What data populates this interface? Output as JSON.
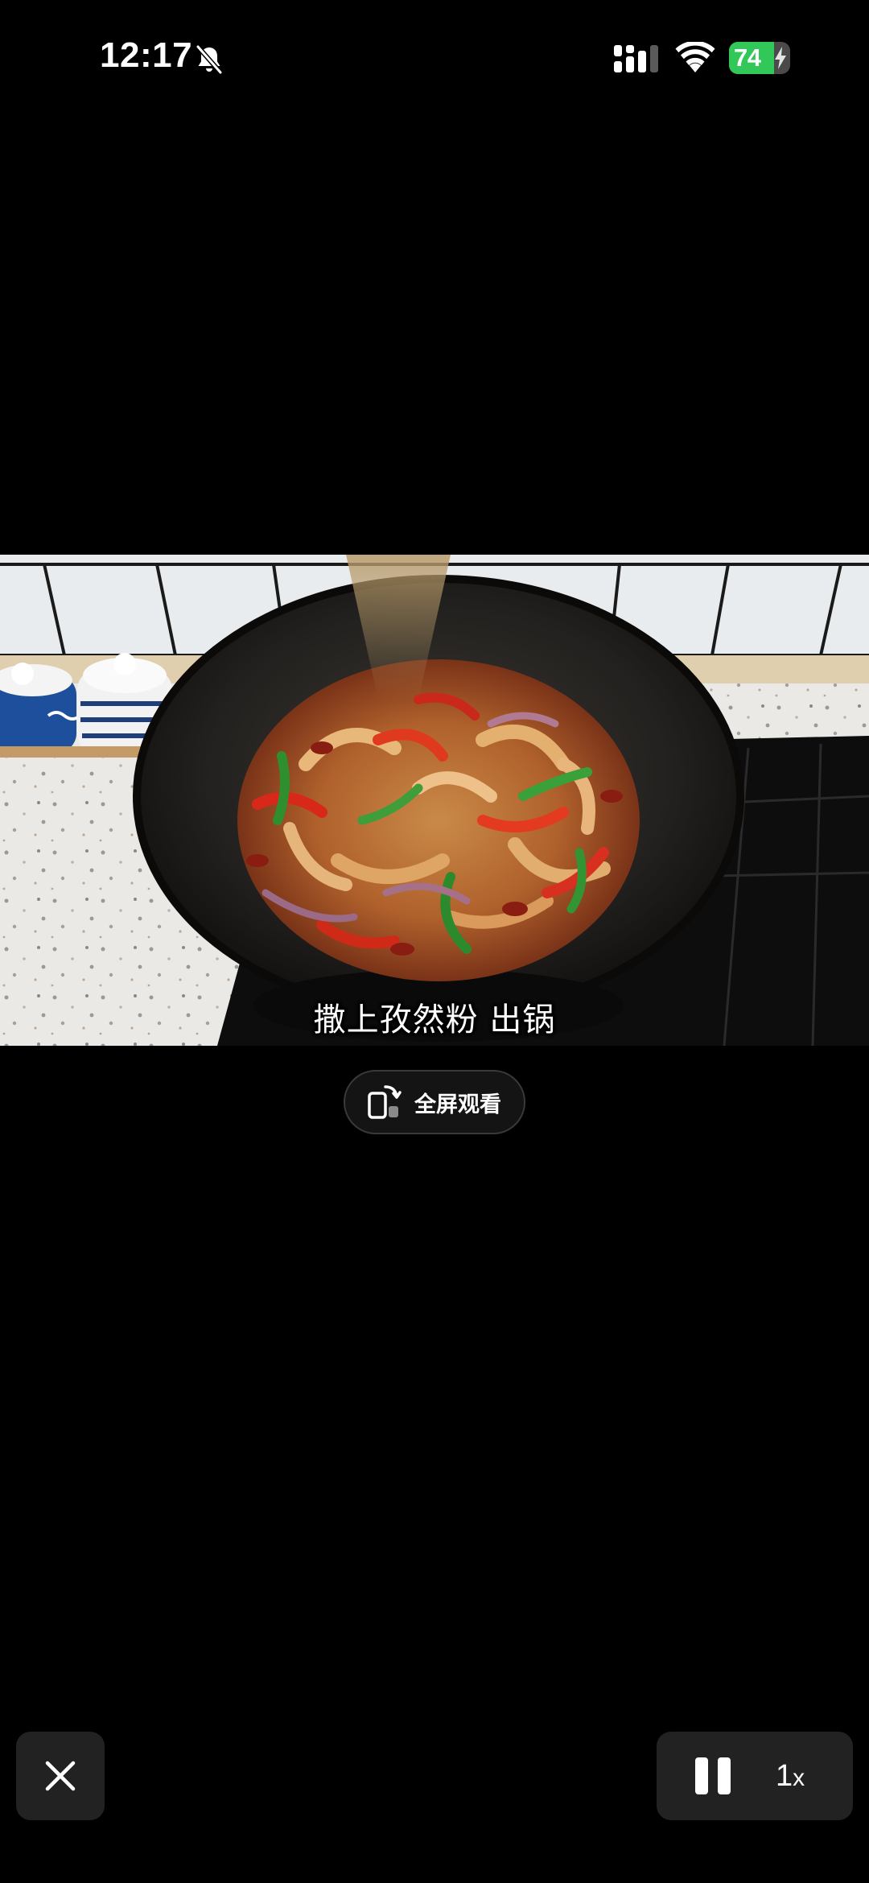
{
  "status_bar": {
    "time": "12:17",
    "battery_percent": "74",
    "battery_level": 0.74,
    "icons": [
      "bell-slash-icon",
      "cellular-signal-icon",
      "wifi-icon",
      "battery-icon",
      "charging-bolt-icon"
    ]
  },
  "video": {
    "subtitle": "撒上孜然粉 出锅"
  },
  "fullscreen_button": {
    "label": "全屏观看",
    "icon": "rotate-phone-icon"
  },
  "controls": {
    "close_icon": "close-icon",
    "pause_icon": "pause-icon",
    "speed_value": "1",
    "speed_unit": "x"
  },
  "colors": {
    "background": "#000000",
    "battery_green": "#32c759",
    "control_bg": "#222222"
  }
}
